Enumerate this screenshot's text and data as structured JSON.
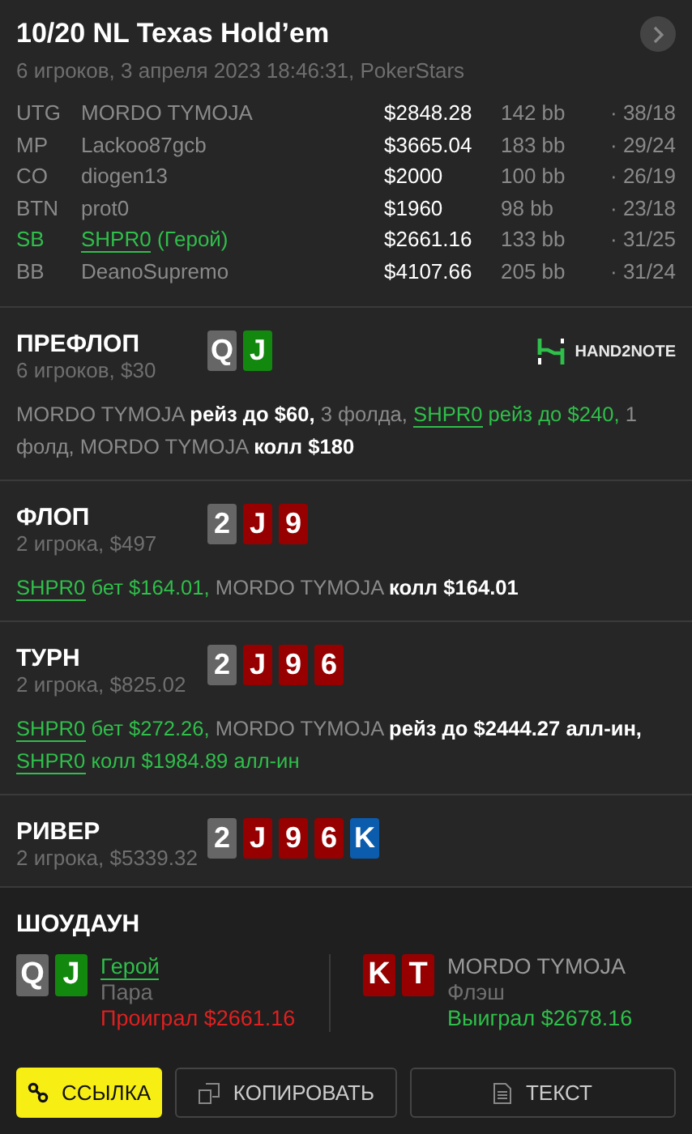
{
  "header": {
    "title": "10/20 NL Texas Hold’em",
    "subtitle": "6 игроков, 3 апреля 2023 18:46:31, PokerStars"
  },
  "players": [
    {
      "position": "UTG",
      "name": "MORDO TYMOJA",
      "hero": false,
      "stack": "$2848.28",
      "bb": "142 bb",
      "stats": "· 38/18"
    },
    {
      "position": "MP",
      "name": "Lackoo87gcb",
      "hero": false,
      "stack": "$3665.04",
      "bb": "183 bb",
      "stats": "· 29/24"
    },
    {
      "position": "CO",
      "name": "diogen13",
      "hero": false,
      "stack": "$2000",
      "bb": "100 bb",
      "stats": "· 26/19"
    },
    {
      "position": "BTN",
      "name": "prot0",
      "hero": false,
      "stack": "$1960",
      "bb": "98 bb",
      "stats": "· 23/18"
    },
    {
      "position": "SB",
      "name": "SHPR0",
      "hero_tag": "(Герой)",
      "hero": true,
      "stack": "$2661.16",
      "bb": "133 bb",
      "stats": "· 31/25"
    },
    {
      "position": "BB",
      "name": "DeanoSupremo",
      "hero": false,
      "stack": "$4107.66",
      "bb": "205 bb",
      "stats": "· 31/24"
    }
  ],
  "streets": [
    {
      "title": "ПРЕФЛОП",
      "subtitle": "6 игроков, $30",
      "logo": "HAND2NOTE",
      "cards": [
        {
          "rank": "Q",
          "color": "#666666"
        },
        {
          "rank": "J",
          "color": "#13880f"
        }
      ],
      "actions": [
        {
          "kind": "player",
          "text": "MORDO TYMOJA"
        },
        {
          "kind": "action",
          "text": "рейз до $60,"
        },
        {
          "kind": "plain",
          "text": "3 фолда,"
        },
        {
          "kind": "hero",
          "text": "SHPR0"
        },
        {
          "kind": "hero_action",
          "text": "рейз до $240,"
        },
        {
          "kind": "plain",
          "text": "1 фолд,"
        },
        {
          "kind": "player",
          "text": "MORDO TYMOJA"
        },
        {
          "kind": "action",
          "text": "колл $180"
        }
      ]
    },
    {
      "title": "ФЛОП",
      "subtitle": "2 игрока, $497",
      "cards": [
        {
          "rank": "2",
          "color": "#666666"
        },
        {
          "rank": "J",
          "color": "#960000"
        },
        {
          "rank": "9",
          "color": "#960000"
        }
      ],
      "actions": [
        {
          "kind": "hero",
          "text": "SHPR0"
        },
        {
          "kind": "hero_action",
          "text": "бет $164.01,"
        },
        {
          "kind": "player",
          "text": "MORDO TYMOJA"
        },
        {
          "kind": "action",
          "text": "колл $164.01"
        }
      ]
    },
    {
      "title": "ТУРН",
      "subtitle": "2 игрока, $825.02",
      "cards": [
        {
          "rank": "2",
          "color": "#666666"
        },
        {
          "rank": "J",
          "color": "#960000"
        },
        {
          "rank": "9",
          "color": "#960000"
        },
        {
          "rank": "6",
          "color": "#960000"
        }
      ],
      "actions": [
        {
          "kind": "hero",
          "text": "SHPR0"
        },
        {
          "kind": "hero_action",
          "text": "бет $272.26,"
        },
        {
          "kind": "player",
          "text": "MORDO TYMOJA"
        },
        {
          "kind": "action",
          "text": "рейз до $2444.27 алл-ин,"
        },
        {
          "kind": "hero",
          "text": "SHPR0"
        },
        {
          "kind": "hero_action",
          "text": "колл $1984.89 алл-ин"
        }
      ]
    },
    {
      "title": "РИВЕР",
      "subtitle": "2 игрока, $5339.32",
      "cards": [
        {
          "rank": "2",
          "color": "#666666"
        },
        {
          "rank": "J",
          "color": "#960000"
        },
        {
          "rank": "9",
          "color": "#960000"
        },
        {
          "rank": "6",
          "color": "#960000"
        },
        {
          "rank": "K",
          "color": "#0b5cad"
        }
      ]
    }
  ],
  "showdown": {
    "title": "ШОУДАУН",
    "hands": [
      {
        "name": "Герой",
        "hero": true,
        "hand": "Пара",
        "result": "Проиграл $2661.16",
        "won": false,
        "cards": [
          {
            "rank": "Q",
            "color": "#666666"
          },
          {
            "rank": "J",
            "color": "#13880f"
          }
        ]
      },
      {
        "name": "MORDO TYMOJA",
        "hero": false,
        "hand": "Флэш",
        "result": "Выиграл $2678.16",
        "won": true,
        "cards": [
          {
            "rank": "K",
            "color": "#960000"
          },
          {
            "rank": "T",
            "color": "#960000"
          }
        ]
      }
    ]
  },
  "buttons": [
    {
      "kind": "link",
      "label": "ССЫЛКА",
      "primary": true
    },
    {
      "kind": "copy",
      "label": "КОПИРОВАТЬ",
      "primary": false
    },
    {
      "kind": "text",
      "label": "ТЕКСТ",
      "primary": false
    }
  ]
}
